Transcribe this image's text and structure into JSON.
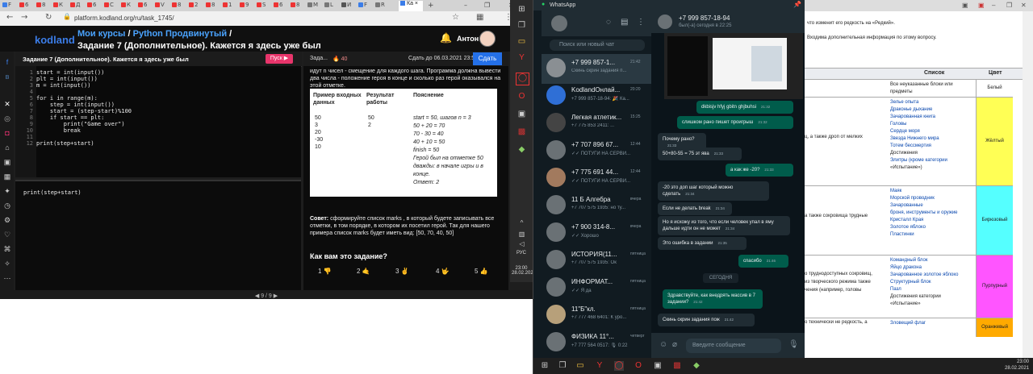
{
  "browser": {
    "url": "platform.kodland.org/ru/task_1745/",
    "logo": "kodland",
    "breadcrumb_link1": "Мои курсы",
    "breadcrumb_sep": "/",
    "breadcrumb_link2": "Python Продвинутый",
    "breadcrumb_sep2": "/",
    "page_title": "Задание 7 (Дополнительное). Кажется я здесь уже был",
    "user_name": "Антон",
    "task_header": "Задание 7 (Дополнительное). Кажется я здесь уже был",
    "run_label": "Пуск ▶",
    "code_lines": [
      "start = int(input())",
      "plt = int(input())",
      "m = int(input())",
      "",
      "for i in range(m):",
      "    step = int(input())",
      "    start = (step-start)%100",
      "    if start == plt:",
      "        print(\"Game over\")",
      "        break",
      "",
      "print(step+start)"
    ],
    "line_numbers": [
      "1",
      "2",
      "3",
      "4",
      "5",
      "6",
      "7",
      "8",
      "9",
      "10",
      "11",
      "12"
    ],
    "console_output": "print(step+start)",
    "pager": "◀  9 / 9  ▶",
    "panel_tab": "Зада...",
    "panel_points": "🔥 40",
    "deadline_label": "Сдать до 06.03.2021 23:59",
    "submit_label": "Сдать",
    "intro_text": "идут n чисел - смещение для каждого шага. Программа должна вывести два числа - положение героя в конце и сколько раз герой оказывался на этой отметке.",
    "sample_headers": [
      "Пример входных данных",
      "Результат работы",
      "Пояснение"
    ],
    "sample_input": [
      "50",
      "3",
      "20",
      "-30",
      "10"
    ],
    "sample_output": [
      "50",
      "2"
    ],
    "sample_explanation": [
      "start = 50, шагов n = 3",
      "50 + 20 = 70",
      "70 - 30 = 40",
      "40 + 10 = 50",
      "finish = 50",
      "Герой был на отметке 50",
      "дважды: в начале игры и в",
      "конце.",
      "Ответ: 2"
    ],
    "tip_label": "Совет:",
    "tip_text": "сформируйте список marks , в который будете записывать все отметки, в том порядке, в котором их посетил герой. Так для нашего примера список marks будет иметь вид: [50, 70, 40, 50]",
    "rating_question": "Как вам это задание?",
    "ratings": [
      "1 👎",
      "2 🤙",
      "3 ✌",
      "4 🤟",
      "5 👍"
    ]
  },
  "vertical_taskbar": {
    "lang": "РУС",
    "time": "23:00",
    "date": "28.02.2021"
  },
  "whatsapp": {
    "title": "WhatsApp",
    "search_placeholder": "Поиск или новый чат",
    "chats": [
      {
        "name": "+7 999 857-1...",
        "time": "21:42",
        "preview": "Скинь скрин задания п..."
      },
      {
        "name": "KodlandОнлай...",
        "time": "20:20",
        "preview": "+7 999 857-18-94: 🎉 Ка..."
      },
      {
        "name": "Легкая атлетик...",
        "time": "15:25",
        "preview": "+7 775 853 2411: ..."
      },
      {
        "name": "+7 707 896 67...",
        "time": "12:44",
        "preview": "✓✓ ПОТУГИ НА СЕРВИ..."
      },
      {
        "name": "+7 775 691 44...",
        "time": "12:44",
        "preview": "✓✓ ПОТУГИ НА СЕРВИ..."
      },
      {
        "name": "11 Б    Алгебра",
        "time": "вчера",
        "preview": "+7 707 575 1935: но ту..."
      },
      {
        "name": "+7 900 314-8...",
        "time": "вчера",
        "preview": "✓✓ Хорошо"
      },
      {
        "name": "ИСТОРИЯ(11...",
        "time": "пятница",
        "preview": "+7 707 575 1935: Ок"
      },
      {
        "name": "ИНФОРМАТ...",
        "time": "пятница",
        "preview": "✓✓ Я да"
      },
      {
        "name": "11\"Б\"кл.",
        "time": "пятница",
        "preview": "+7 777 468 6401: К уро..."
      },
      {
        "name": "ФИЗИКА 11°...",
        "time": "четверг",
        "preview": "+7 777 564 0517: 🎙 0:22"
      }
    ],
    "active_chat_name": "+7 999 857-18-94",
    "active_chat_status": "был(-а) сегодня в 22:25",
    "messages": [
      {
        "dir": "out",
        "text": "dkbisjv hfyj gbitn ghjbuhsi",
        "time": "21:32"
      },
      {
        "dir": "out",
        "text": "слишком рано пишет проигрыш",
        "time": "21:32"
      },
      {
        "dir": "in",
        "text": "Почему рано?",
        "time": "21:33"
      },
      {
        "dir": "in",
        "text": "50+80-55 = 75 эт ява",
        "time": "21:33"
      },
      {
        "dir": "out",
        "text": "а как же -20?",
        "time": "21:33"
      },
      {
        "dir": "in",
        "text": "-20 это доп шаг который можно сделать",
        "time": "21:34"
      },
      {
        "dir": "in",
        "text": "Если не делать break",
        "time": "21:34"
      },
      {
        "dir": "in",
        "text": "Но я исхожу из того, что если человек упал в яму дальше идти он не может",
        "time": "21:34"
      },
      {
        "dir": "in",
        "text": "Это ошибка в задании",
        "time": "21:35"
      },
      {
        "dir": "out",
        "text": "спасибо",
        "time": "21:46"
      },
      {
        "dir": "out",
        "text": "Здравствуйте, как внедрять массив в 7 задании?",
        "time": "21:42"
      },
      {
        "dir": "in",
        "text": "Скинь скрин задания пож",
        "time": "21:42"
      }
    ],
    "date_separator": "СЕГОДНЯ",
    "input_placeholder": "Введите сообщение"
  },
  "rightpage": {
    "line1": "что изменит его редкость на «Редкий».",
    "line2": "Входима дополнительная информация по этому вопросу.",
    "col_list": "Список",
    "col_color": "Цвет",
    "rows": [
      {
        "items": [
          "Все неуказанные блоки или",
          "предметы"
        ],
        "color_name": "Белый",
        "color": "#ffffff"
      },
      {
        "items": [
          "Зелье опыта",
          "Драконье дыхание",
          "Зачарованная книга",
          "Головы",
          "Сердце моря",
          "Звезда Нижнего мира",
          "Тотем бессмертия",
          "Достижения",
          "Элитры (кроме категории",
          "«Испытание»)"
        ],
        "color_name": "Жёлтый",
        "color": "#ffff55"
      },
      {
        "items": [
          "Маяк",
          "Морской проводник",
          "",
          "Зачарованные",
          "броня, инструменты и оружие",
          "Кристалл Края",
          "Золотое яблоко",
          "Пластинки"
        ],
        "color_name": "Бирюзовый",
        "color": "#55ffff"
      },
      {
        "items": [
          "Командный блок",
          "Яйцо дракона",
          "Зачарованное золотое яблоко",
          "Структурный блок",
          "Пазл",
          "Достижения категории",
          "«Испытание»"
        ],
        "color_name": "Пурпурный",
        "color": "#ff55ff"
      },
      {
        "items": [
          "Зловещий флаг"
        ],
        "color_name": "Оранжевый",
        "color": "#ffaa00"
      }
    ],
    "side_text": [
      "ц, а также дроп от мелких",
      "а также сокровища трудные",
      "о труднодоступных сокровищ,",
      "из творческого режима также",
      "чения (например, головы",
      "о технически не редкость, а"
    ]
  },
  "bottom_taskbar": {
    "time": "23:00",
    "date": "28.02.2021"
  }
}
